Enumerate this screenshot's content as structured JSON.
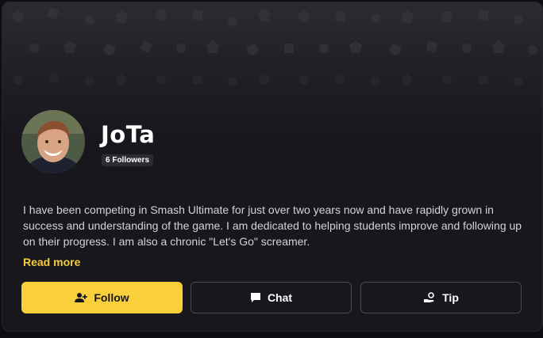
{
  "profile": {
    "name": "JoTa",
    "followers": "6 Followers",
    "bio": "I have been competing in Smash Ultimate for just over two years now and have rapidly grown in success and understanding of the game. I am dedicated to helping students improve and following up on their progress. I am also a chronic \"Let's Go\" screamer.",
    "read_more": "Read more"
  },
  "actions": {
    "follow": "Follow",
    "chat": "Chat",
    "tip": "Tip"
  },
  "colors": {
    "accent": "#f9cf3b",
    "background": "#18171d"
  },
  "icons": [
    "person-plus-icon",
    "chat-bubble-icon",
    "hand-coin-icon"
  ]
}
